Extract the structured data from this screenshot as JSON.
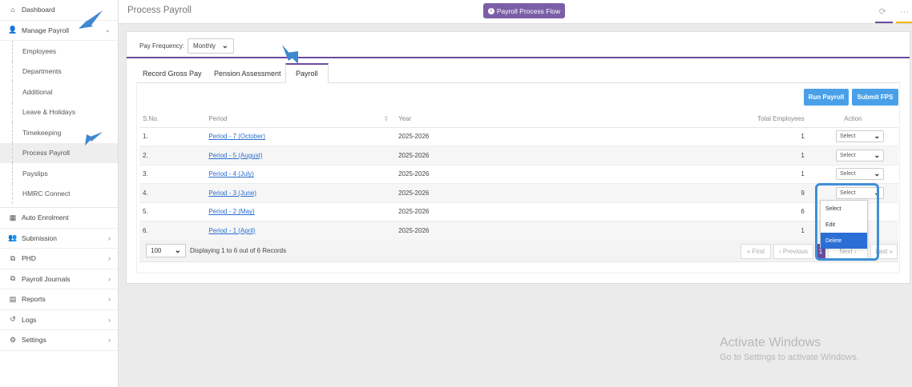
{
  "sidebar": {
    "items": [
      {
        "label": "Dashboard",
        "icon": "home-icon",
        "glyph": "⌂",
        "chev": ""
      },
      {
        "label": "Manage Payroll",
        "icon": "user-icon",
        "glyph": "👤",
        "chev": "⌄"
      }
    ],
    "subitems": [
      {
        "label": "Employees"
      },
      {
        "label": "Departments"
      },
      {
        "label": "Additional"
      },
      {
        "label": "Leave & Holidays"
      },
      {
        "label": "Timekeeping"
      },
      {
        "label": "Process Payroll"
      },
      {
        "label": "Payslips"
      },
      {
        "label": "HMRC Connect"
      }
    ],
    "lower": [
      {
        "label": "Auto Enrolment",
        "icon": "grid-icon",
        "glyph": "▦",
        "chev": ""
      },
      {
        "label": "Submission",
        "icon": "users-icon",
        "glyph": "👥",
        "chev": "›"
      },
      {
        "label": "PHD",
        "icon": "copy-icon",
        "glyph": "⧉",
        "chev": "›"
      },
      {
        "label": "Payroll Journals",
        "icon": "copy-icon",
        "glyph": "⧉",
        "chev": "›"
      },
      {
        "label": "Reports",
        "icon": "report-icon",
        "glyph": "▤",
        "chev": "›"
      },
      {
        "label": "Logs",
        "icon": "history-icon",
        "glyph": "↺",
        "chev": "›"
      },
      {
        "label": "Settings",
        "icon": "gear-icon",
        "glyph": "⚙",
        "chev": "›"
      }
    ]
  },
  "header": {
    "title": "Process Payroll",
    "flow_button": "Payroll Process Flow"
  },
  "filters": {
    "pay_frequency_label": "Pay Frequency:",
    "pay_frequency_value": "Monthly"
  },
  "tabs": [
    "Record Gross Pay",
    "Pension Assessment",
    "Payroll"
  ],
  "actions": {
    "run": "Run Payroll",
    "submit": "Submit FPS"
  },
  "table": {
    "headers": [
      "S.No.",
      "Period",
      "Year",
      "Total Employees",
      "Action"
    ],
    "rows": [
      {
        "sno": "1.",
        "period": "Period - 7 (October)",
        "year": "2025-2026",
        "employees": "1",
        "action": "Select"
      },
      {
        "sno": "2.",
        "period": "Period - 5 (August)",
        "year": "2025-2026",
        "employees": "1",
        "action": "Select"
      },
      {
        "sno": "3.",
        "period": "Period - 4 (July)",
        "year": "2025-2026",
        "employees": "1",
        "action": "Select"
      },
      {
        "sno": "4.",
        "period": "Period - 3 (June)",
        "year": "2025-2026",
        "employees": "9",
        "action": "Select"
      },
      {
        "sno": "5.",
        "period": "Period - 2 (May)",
        "year": "2025-2026",
        "employees": "6",
        "action": ""
      },
      {
        "sno": "6.",
        "period": "Period - 1 (April)",
        "year": "2025-2026",
        "employees": "1",
        "action": ""
      }
    ]
  },
  "dropdown": {
    "options": [
      "Select",
      "Edit",
      "Delete"
    ],
    "highlighted": "Delete"
  },
  "pager": {
    "per_page": "100",
    "summary": "Displaying 1 to 6 out of 6 Records",
    "first": "« First",
    "prev": "‹ Previous",
    "current": "1",
    "next": "Next ›",
    "last": "Last »"
  },
  "watermark": {
    "line1": "Activate Windows",
    "line2": "Go to Settings to activate Windows."
  },
  "colors": {
    "accent": "#6a4c9c",
    "button": "#4aa0e8",
    "link": "#2a6ed1",
    "highlight": "#2b6fd6",
    "annotation": "#3f8fd6"
  }
}
